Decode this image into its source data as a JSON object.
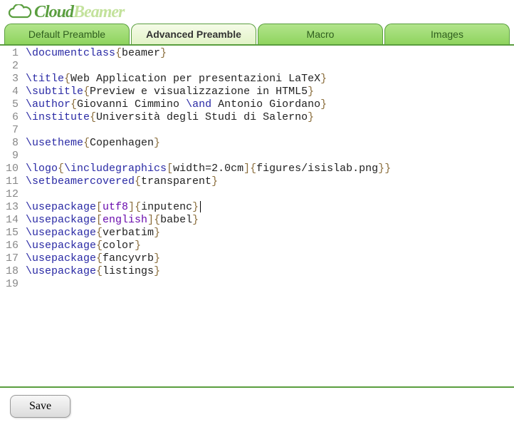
{
  "logo": {
    "part1": "Cloud",
    "part2": "Beamer"
  },
  "tabs": [
    {
      "label": "Default Preamble",
      "active": false
    },
    {
      "label": "Advanced Preamble",
      "active": true
    },
    {
      "label": "Macro",
      "active": false
    },
    {
      "label": "Images",
      "active": false
    }
  ],
  "code": {
    "lines": [
      [
        {
          "t": "cmd",
          "v": "\\documentclass"
        },
        {
          "t": "brkt",
          "v": "{"
        },
        {
          "t": "txt",
          "v": "beamer"
        },
        {
          "t": "brkt",
          "v": "}"
        }
      ],
      [],
      [
        {
          "t": "cmd",
          "v": "\\title"
        },
        {
          "t": "brkt",
          "v": "{"
        },
        {
          "t": "txt",
          "v": "Web Application per presentazioni LaTeX"
        },
        {
          "t": "brkt",
          "v": "}"
        }
      ],
      [
        {
          "t": "cmd",
          "v": "\\subtitle"
        },
        {
          "t": "brkt",
          "v": "{"
        },
        {
          "t": "txt",
          "v": "Preview e visualizzazione in HTML5"
        },
        {
          "t": "brkt",
          "v": "}"
        }
      ],
      [
        {
          "t": "cmd",
          "v": "\\author"
        },
        {
          "t": "brkt",
          "v": "{"
        },
        {
          "t": "txt",
          "v": "Giovanni Cimmino "
        },
        {
          "t": "cmd",
          "v": "\\and"
        },
        {
          "t": "txt",
          "v": " Antonio Giordano"
        },
        {
          "t": "brkt",
          "v": "}"
        }
      ],
      [
        {
          "t": "cmd",
          "v": "\\institute"
        },
        {
          "t": "brkt",
          "v": "{"
        },
        {
          "t": "txt",
          "v": "Università degli Studi di Salerno"
        },
        {
          "t": "brkt",
          "v": "}"
        }
      ],
      [],
      [
        {
          "t": "cmd",
          "v": "\\usetheme"
        },
        {
          "t": "brkt",
          "v": "{"
        },
        {
          "t": "txt",
          "v": "Copenhagen"
        },
        {
          "t": "brkt",
          "v": "}"
        }
      ],
      [],
      [
        {
          "t": "cmd",
          "v": "\\logo"
        },
        {
          "t": "brkt",
          "v": "{"
        },
        {
          "t": "cmd",
          "v": "\\includegraphics"
        },
        {
          "t": "brkt",
          "v": "["
        },
        {
          "t": "txt",
          "v": "width=2.0cm"
        },
        {
          "t": "brkt",
          "v": "]"
        },
        {
          "t": "brkt",
          "v": "{"
        },
        {
          "t": "txt",
          "v": "figures/isislab.png"
        },
        {
          "t": "brkt",
          "v": "}"
        },
        {
          "t": "brkt",
          "v": "}"
        }
      ],
      [
        {
          "t": "cmd",
          "v": "\\setbeamercovered"
        },
        {
          "t": "brkt",
          "v": "{"
        },
        {
          "t": "txt",
          "v": "transparent"
        },
        {
          "t": "brkt",
          "v": "}"
        }
      ],
      [],
      [
        {
          "t": "cmd",
          "v": "\\usepackage"
        },
        {
          "t": "brkt",
          "v": "["
        },
        {
          "t": "opt",
          "v": "utf8"
        },
        {
          "t": "brkt",
          "v": "]"
        },
        {
          "t": "brkt",
          "v": "{"
        },
        {
          "t": "txt",
          "v": "inputenc"
        },
        {
          "t": "brkt",
          "v": "}"
        },
        {
          "t": "cursor",
          "v": ""
        }
      ],
      [
        {
          "t": "cmd",
          "v": "\\usepackage"
        },
        {
          "t": "brkt",
          "v": "["
        },
        {
          "t": "opt",
          "v": "english"
        },
        {
          "t": "brkt",
          "v": "]"
        },
        {
          "t": "brkt",
          "v": "{"
        },
        {
          "t": "txt",
          "v": "babel"
        },
        {
          "t": "brkt",
          "v": "}"
        }
      ],
      [
        {
          "t": "cmd",
          "v": "\\usepackage"
        },
        {
          "t": "brkt",
          "v": "{"
        },
        {
          "t": "txt",
          "v": "verbatim"
        },
        {
          "t": "brkt",
          "v": "}"
        }
      ],
      [
        {
          "t": "cmd",
          "v": "\\usepackage"
        },
        {
          "t": "brkt",
          "v": "{"
        },
        {
          "t": "txt",
          "v": "color"
        },
        {
          "t": "brkt",
          "v": "}"
        }
      ],
      [
        {
          "t": "cmd",
          "v": "\\usepackage"
        },
        {
          "t": "brkt",
          "v": "{"
        },
        {
          "t": "txt",
          "v": "fancyvrb"
        },
        {
          "t": "brkt",
          "v": "}"
        }
      ],
      [
        {
          "t": "cmd",
          "v": "\\usepackage"
        },
        {
          "t": "brkt",
          "v": "{"
        },
        {
          "t": "txt",
          "v": "listings"
        },
        {
          "t": "brkt",
          "v": "}"
        }
      ],
      []
    ]
  },
  "footer": {
    "save_label": "Save"
  }
}
